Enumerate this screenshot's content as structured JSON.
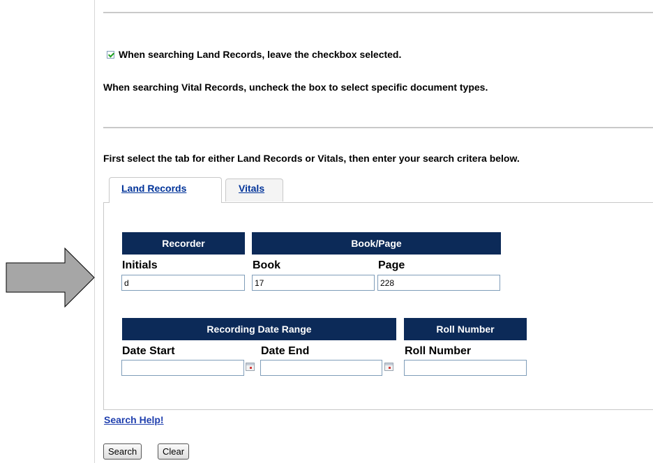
{
  "notice": {
    "land_records_hint": "When searching Land Records, leave the checkbox selected.",
    "vital_records_hint": "When searching Vital Records, uncheck the box to select specific document types.",
    "checkbox_checked": true
  },
  "instructions": "First select the tab for either Land Records or Vitals, then enter your search critera below.",
  "tabs": [
    {
      "label": "Land Records",
      "active": true
    },
    {
      "label": "Vitals",
      "active": false
    }
  ],
  "form": {
    "recorder": {
      "header": "Recorder",
      "initials_label": "Initials",
      "initials_value": "d"
    },
    "book_page": {
      "header": "Book/Page",
      "book_label": "Book",
      "book_value": "17",
      "page_label": "Page",
      "page_value": "228"
    },
    "date_range": {
      "header": "Recording Date Range",
      "start_label": "Date Start",
      "start_value": "",
      "end_label": "Date End",
      "end_value": ""
    },
    "roll": {
      "header": "Roll Number",
      "label": "Roll Number",
      "value": ""
    }
  },
  "links": {
    "search_help": "Search Help!"
  },
  "buttons": {
    "search": "Search",
    "clear": "Clear"
  },
  "colors": {
    "header_bg": "#0c2a58",
    "link": "#1f3fae"
  },
  "icons": {
    "arrow": "right-arrow-icon",
    "calendar": "calendar-icon"
  }
}
